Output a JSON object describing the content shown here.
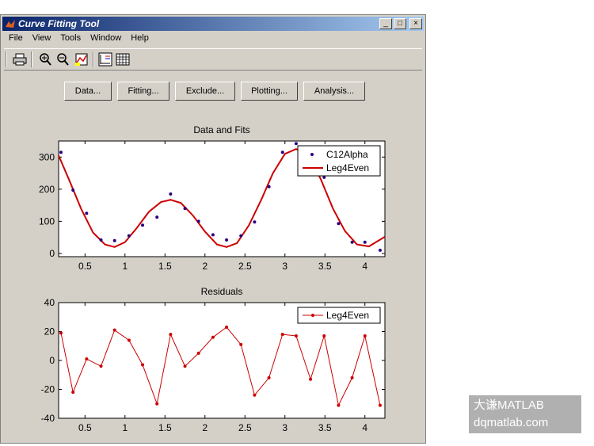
{
  "window": {
    "title": "Curve Fitting Tool",
    "min_label": "_",
    "max_label": "□",
    "close_label": "×"
  },
  "menu": [
    "File",
    "View",
    "Tools",
    "Window",
    "Help"
  ],
  "toolbar_icons": [
    "print-icon",
    "zoom-in-icon",
    "zoom-out-icon",
    "data-cursor-icon",
    "legend-icon",
    "grid-icon"
  ],
  "buttons": [
    "Data...",
    "Fitting...",
    "Exclude...",
    "Plotting...",
    "Analysis..."
  ],
  "colors": {
    "data_point": "#2b0080",
    "fit_line": "#cc0000",
    "residual": "#cc0000",
    "title_bar": "#0a246a"
  },
  "watermark": {
    "line1": "大谦MATLAB",
    "line2": "dqmatlab.com"
  },
  "chart_data": [
    {
      "type": "scatter",
      "title": "Data and Fits",
      "xlim": [
        0.17,
        4.25
      ],
      "ylim": [
        -10,
        350
      ],
      "xticks": [
        "0.5",
        "1",
        "1.5",
        "2",
        "2.5",
        "3",
        "3.5",
        "4"
      ],
      "xtick_values": [
        0.5,
        1,
        1.5,
        2,
        2.5,
        3,
        3.5,
        4
      ],
      "yticks": [
        "0",
        "100",
        "200",
        "300"
      ],
      "ytick_values": [
        0,
        100,
        200,
        300
      ],
      "legend": [
        "C12Alpha",
        "Leg4Even"
      ],
      "legend_position": "top-right",
      "series": [
        {
          "name": "C12Alpha",
          "x": [
            0.2,
            0.35,
            0.52,
            0.7,
            0.87,
            1.05,
            1.22,
            1.4,
            1.57,
            1.75,
            1.92,
            2.1,
            2.27,
            2.45,
            2.62,
            2.8,
            2.97,
            3.14,
            3.32,
            3.49,
            3.67,
            3.84,
            4.0,
            4.19
          ],
          "y": [
            315,
            197,
            125,
            42,
            40,
            55,
            88,
            113,
            185,
            140,
            100,
            58,
            42,
            55,
            98,
            208,
            315,
            342,
            270,
            237,
            93,
            35,
            35,
            10
          ]
        },
        {
          "name": "Leg4Even",
          "x": [
            0.17,
            0.3,
            0.45,
            0.6,
            0.75,
            0.87,
            1.0,
            1.15,
            1.3,
            1.45,
            1.57,
            1.7,
            1.85,
            2.0,
            2.15,
            2.27,
            2.4,
            2.55,
            2.7,
            2.85,
            3.0,
            3.14,
            3.3,
            3.45,
            3.6,
            3.75,
            3.9,
            4.05,
            4.25
          ],
          "y": [
            305,
            230,
            140,
            65,
            28,
            20,
            35,
            80,
            130,
            160,
            167,
            157,
            118,
            68,
            28,
            20,
            32,
            88,
            165,
            250,
            310,
            325,
            305,
            230,
            140,
            70,
            28,
            22,
            52
          ]
        }
      ]
    },
    {
      "type": "line",
      "title": "Residuals",
      "xlim": [
        0.17,
        4.25
      ],
      "ylim": [
        -40,
        40
      ],
      "xticks": [
        "0.5",
        "1",
        "1.5",
        "2",
        "2.5",
        "3",
        "3.5",
        "4"
      ],
      "xtick_values": [
        0.5,
        1,
        1.5,
        2,
        2.5,
        3,
        3.5,
        4
      ],
      "yticks": [
        "40",
        "20",
        "0",
        "-20",
        "-40"
      ],
      "ytick_values": [
        40,
        20,
        0,
        -20,
        -40
      ],
      "legend": [
        "Leg4Even"
      ],
      "legend_position": "top-right",
      "series": [
        {
          "name": "Leg4Even",
          "x": [
            0.2,
            0.35,
            0.52,
            0.7,
            0.87,
            1.05,
            1.22,
            1.4,
            1.57,
            1.75,
            1.92,
            2.1,
            2.27,
            2.45,
            2.62,
            2.8,
            2.97,
            3.14,
            3.32,
            3.49,
            3.67,
            3.84,
            4.0,
            4.19
          ],
          "y": [
            19,
            -22,
            1,
            -4,
            21,
            14,
            -3,
            -30,
            18,
            -4,
            5,
            16,
            23,
            11,
            -24,
            -12,
            18,
            17,
            -13,
            17,
            -31,
            -12,
            17,
            -31
          ]
        }
      ]
    }
  ]
}
